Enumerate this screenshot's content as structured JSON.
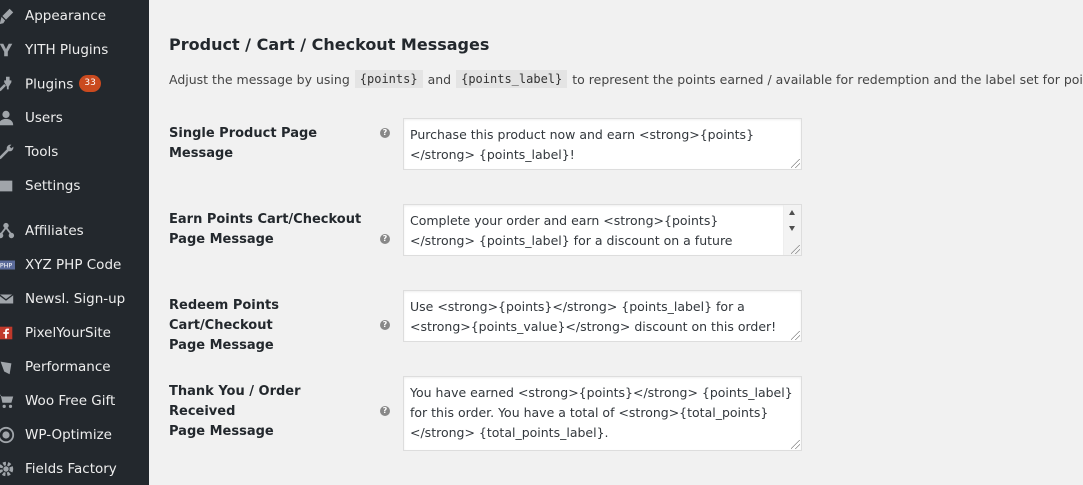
{
  "sidebar": {
    "items": [
      {
        "label": "Appearance",
        "icon": "paintbrush-icon"
      },
      {
        "label": "YITH Plugins",
        "icon": "yith-icon"
      },
      {
        "label": "Plugins",
        "icon": "plug-icon",
        "badge": "33"
      },
      {
        "label": "Users",
        "icon": "user-icon"
      },
      {
        "label": "Tools",
        "icon": "wrench-icon"
      },
      {
        "label": "Settings",
        "icon": "settings-icon"
      },
      {
        "label": "Affiliates",
        "icon": "affiliates-icon"
      },
      {
        "label": "XYZ PHP Code",
        "icon": "php-icon"
      },
      {
        "label": "Newsl. Sign-up",
        "icon": "envelope-icon"
      },
      {
        "label": "PixelYourSite",
        "icon": "facebook-icon"
      },
      {
        "label": "Performance",
        "icon": "performance-icon"
      },
      {
        "label": "Woo Free Gift",
        "icon": "cart-icon"
      },
      {
        "label": "WP-Optimize",
        "icon": "optimize-icon"
      },
      {
        "label": "Fields Factory",
        "icon": "gear-icon"
      }
    ],
    "badge_color": "#ca4a1f"
  },
  "main": {
    "title": "Product / Cart / Checkout Messages",
    "description": {
      "prefix": "Adjust the message by using",
      "code1": "{points}",
      "and": "and",
      "code2": "{points_label}",
      "suffix": "to represent the points earned / available for redemption and the label set for points."
    },
    "fields": [
      {
        "label_line1": "Single Product Page Message",
        "label_line2": "",
        "value": "Purchase this product now and earn <strong>{points}</strong> {points_label}!"
      },
      {
        "label_line1": "Earn Points Cart/Checkout",
        "label_line2": "Page Message",
        "value": "Complete your order and earn <strong>{points}</strong> {points_label} for a discount on a future purchase. Create"
      },
      {
        "label_line1": "Redeem Points Cart/Checkout",
        "label_line2": "Page Message",
        "value": "Use <strong>{points}</strong> {points_label} for a <strong>{points_value}</strong> discount on this order!"
      },
      {
        "label_line1": "Thank You / Order Received",
        "label_line2": "Page Message",
        "value": "You have earned <strong>{points}</strong> {points_label} for this order. You have a total of <strong>{total_points}</strong> {total_points_label}."
      }
    ],
    "help_glyph": "?"
  },
  "colors": {
    "sidebar_bg": "#23282d",
    "page_bg": "#f1f1f1"
  }
}
